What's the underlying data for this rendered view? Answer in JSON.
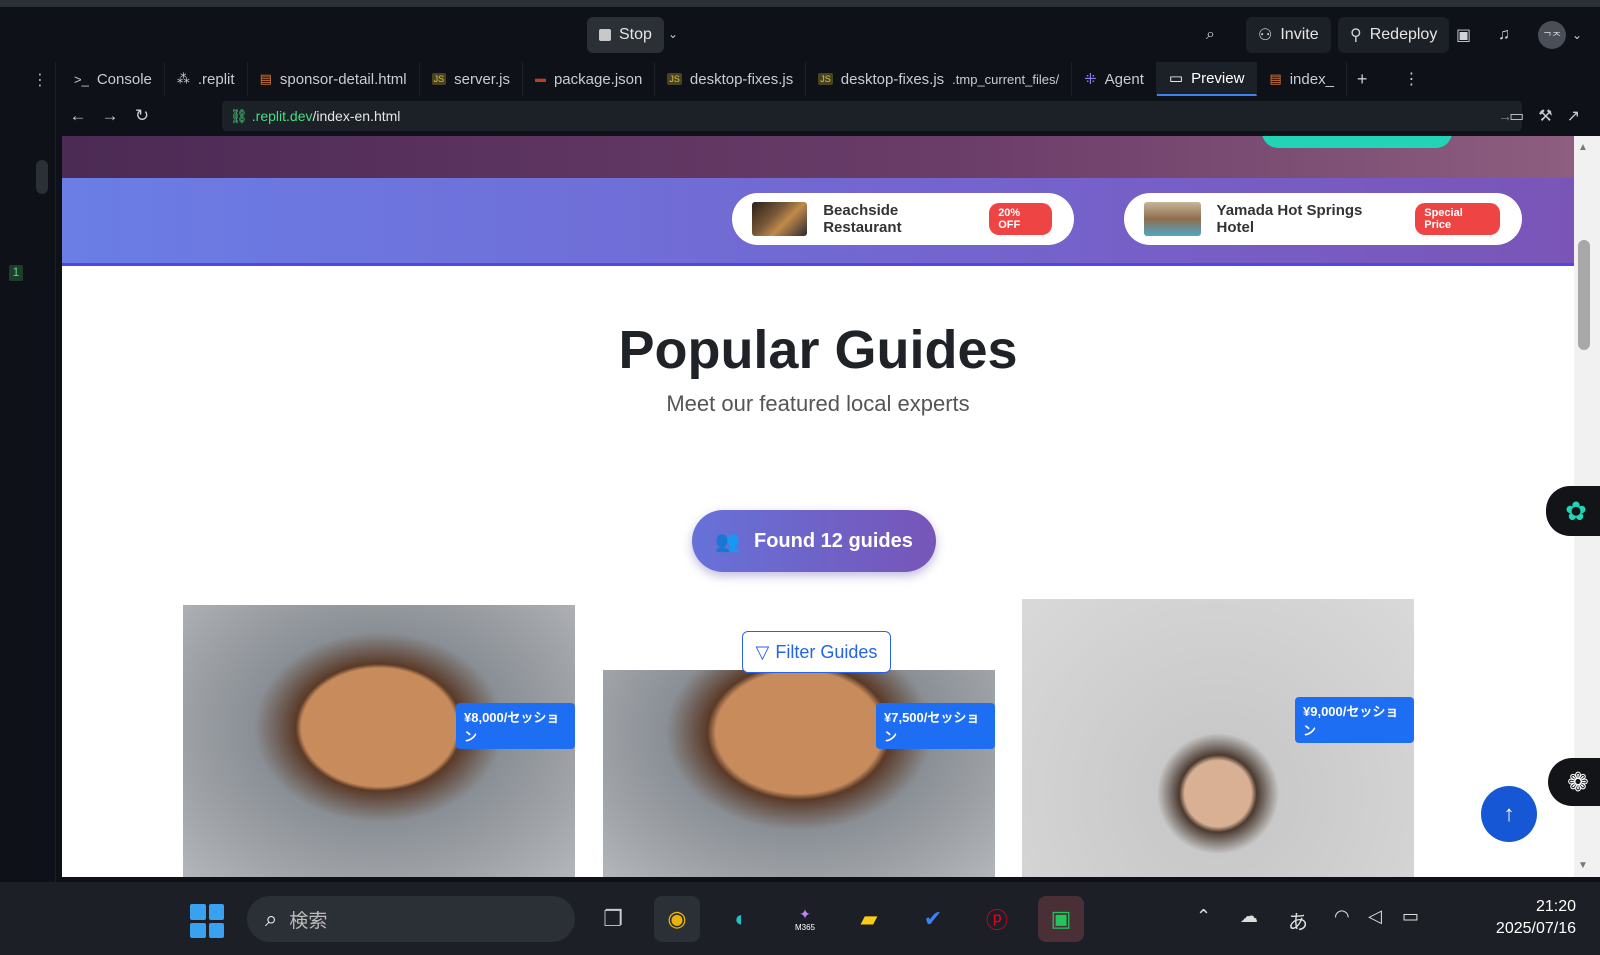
{
  "topbar": {
    "stop_label": "Stop",
    "invite_label": "Invite",
    "redeploy_label": "Redeploy",
    "avatar_text": "ᄀᄌ"
  },
  "leftrail": {
    "badge": "1"
  },
  "tabs": [
    {
      "label": "Console"
    },
    {
      "label": ".replit"
    },
    {
      "label": "sponsor-detail.html"
    },
    {
      "label": "server.js"
    },
    {
      "label": "package.json"
    },
    {
      "label": "desktop-fixes.js"
    },
    {
      "label": "desktop-fixes.js",
      "suffix": ".tmp_current_files/"
    },
    {
      "label": "Agent"
    },
    {
      "label": "Preview"
    },
    {
      "label": "index_"
    }
  ],
  "url": {
    "domain": ".replit.dev",
    "path": "/index-en.html"
  },
  "sponsors": [
    {
      "name": "Beachside Restaurant",
      "tag": "20% OFF"
    },
    {
      "name": "Yamada Hot Springs Hotel",
      "tag": "Special Price"
    }
  ],
  "section": {
    "title": "Popular Guides",
    "subtitle": "Meet our featured local experts",
    "found_label": "Found 12 guides",
    "filter_label": "Filter Guides"
  },
  "guides": [
    {
      "price": "¥8,000/セッション"
    },
    {
      "price": "¥7,500/セッション"
    },
    {
      "price": "¥9,000/セッション"
    }
  ],
  "taskbar": {
    "search_placeholder": "検索",
    "ime": "あ",
    "time": "21:20",
    "date": "2025/07/16",
    "m365_label": "M365"
  }
}
